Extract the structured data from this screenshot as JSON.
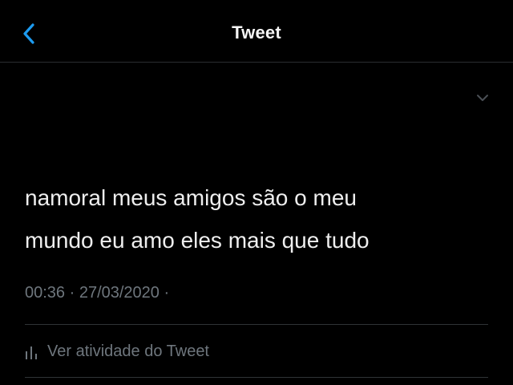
{
  "header": {
    "title": "Tweet",
    "back_icon": "chevron-left-icon",
    "accent_color": "#1d9bf0"
  },
  "tweet": {
    "text_line_1": "namoral meus amigos são o meu",
    "text_line_2": "mundo eu amo eles mais que tudo",
    "meta": "00:36 · 27/03/2020 ·",
    "caret_icon": "chevron-down-icon"
  },
  "activity": {
    "label": "Ver atividade do Tweet",
    "icon": "bar-chart-icon"
  }
}
